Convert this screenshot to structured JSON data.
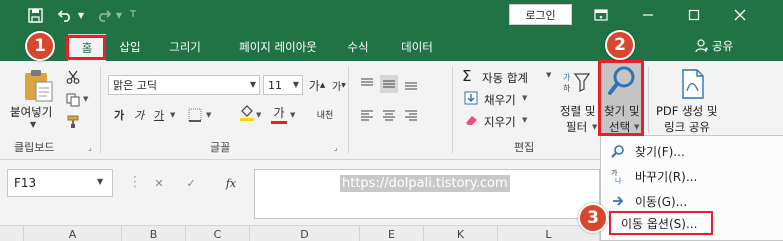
{
  "titlebar": {
    "login_label": "로그인"
  },
  "tabs": [
    {
      "label": "홈"
    },
    {
      "label": "삽입"
    },
    {
      "label": "그리기"
    },
    {
      "label": "페이지 레이아웃"
    },
    {
      "label": "수식"
    },
    {
      "label": "데이터"
    }
  ],
  "share_label": "공유",
  "ribbon": {
    "clipboard": {
      "paste_label": "붙여넣기",
      "group_label": "클립보드"
    },
    "font": {
      "font_name": "맑은 고딕",
      "font_size": "11",
      "bold": "가",
      "italic": "가",
      "underline": "가",
      "color_letter": "가",
      "phonetic": "내천",
      "group_label": "글꼴"
    },
    "editing": {
      "autosum": "자동 합계",
      "fill": "채우기",
      "clear": "지우기",
      "sort_filter_line1": "정렬 및",
      "sort_filter_line2": "필터",
      "find_select_line1": "찾기 및",
      "find_select_line2": "선택",
      "group_label": "편집"
    },
    "pdf": {
      "line1": "PDF 생성 및",
      "line2": "링크 공유"
    }
  },
  "formula_bar": {
    "name_box": "F13",
    "fx": "fx",
    "watermark": "https://dolpali.tistory.com"
  },
  "columns": [
    "A",
    "B",
    "C",
    "D",
    "E",
    "K",
    "L"
  ],
  "find_menu": {
    "items": [
      {
        "label": "찾기(F)..."
      },
      {
        "label": "바꾸기(R)..."
      },
      {
        "label": "이동(G)..."
      },
      {
        "label": "이동 옵션(S)..."
      }
    ]
  },
  "badges": [
    "1",
    "2",
    "3"
  ],
  "colors": {
    "excel_green": "#217346",
    "callout_red": "#e8202a",
    "badge_fill": "#d7472d"
  }
}
